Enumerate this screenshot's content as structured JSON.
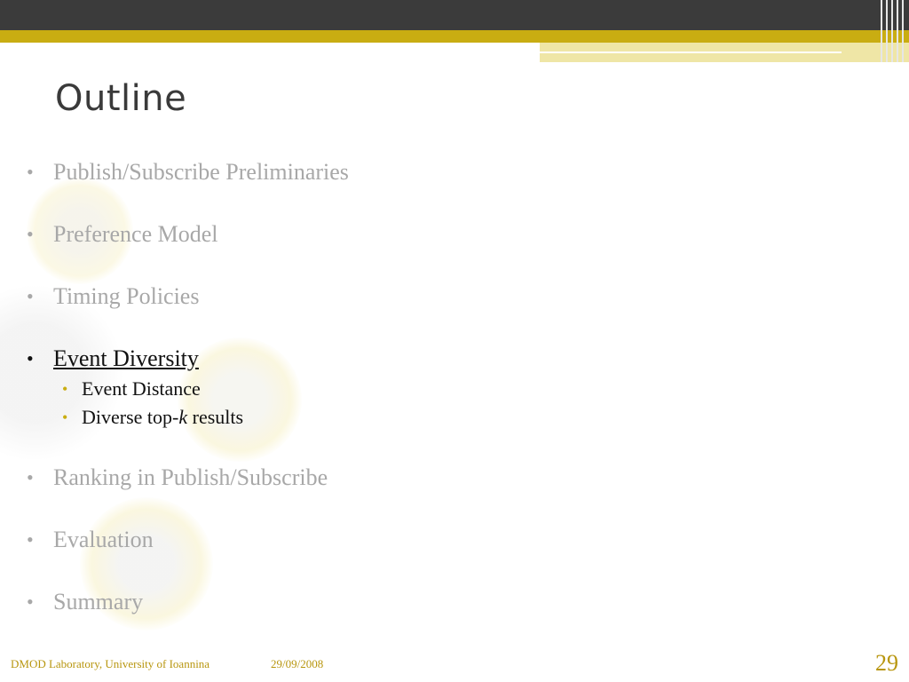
{
  "slide": {
    "title": "Outline",
    "items": [
      {
        "label": "Publish/Subscribe Preliminaries",
        "active": false
      },
      {
        "label": "Preference Model",
        "active": false
      },
      {
        "label": "Timing Policies",
        "active": false
      },
      {
        "label": "Event Diversity",
        "active": true,
        "subitems": [
          {
            "label": "Event Distance"
          },
          {
            "label_prefix": "Diverse top-",
            "label_italic": "k",
            "label_suffix": " results"
          }
        ]
      },
      {
        "label": "Ranking in Publish/Subscribe",
        "active": false
      },
      {
        "label": "Evaluation",
        "active": false
      },
      {
        "label": "Summary",
        "active": false
      }
    ],
    "bullet_glyph": "•"
  },
  "footer": {
    "organization": "DMOD Laboratory, University of Ioannina",
    "date": "29/09/2008",
    "page_number": "29"
  },
  "colors": {
    "top_bar": "#3b3b3b",
    "accent_gold": "#c9ad12",
    "inactive_text": "#a8a8a8",
    "active_text": "#111111",
    "footer_text": "#b8960f"
  }
}
